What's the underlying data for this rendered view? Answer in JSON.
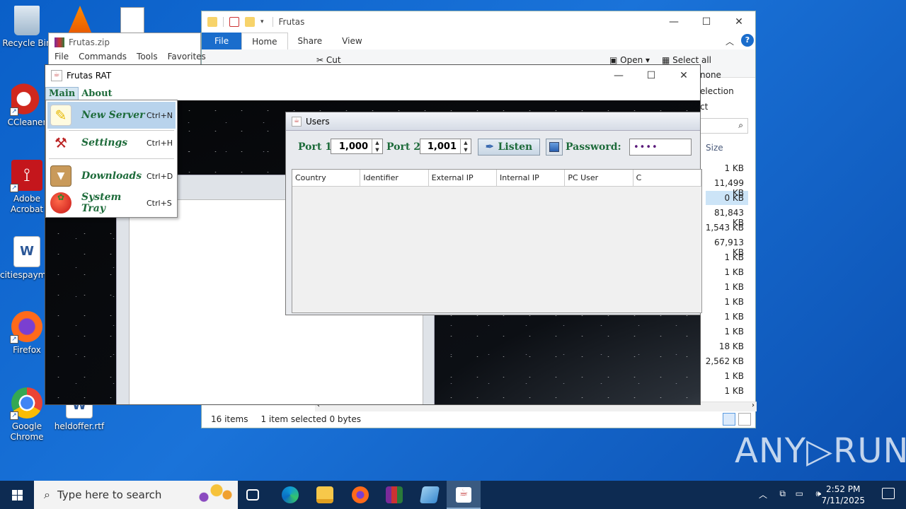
{
  "desktop": {
    "icons": [
      {
        "label": "Recycle Bin",
        "icon": "recycle-bin-icon"
      },
      {
        "label": "CCleaner",
        "icon": "ccleaner-icon"
      },
      {
        "label": "Adobe Acrobat",
        "icon": "adobe-acrobat-icon"
      },
      {
        "label": "citiespaym...",
        "icon": "word-document-icon"
      },
      {
        "label": "Firefox",
        "icon": "firefox-icon"
      },
      {
        "label": "Google Chrome",
        "icon": "chrome-icon"
      },
      {
        "label": "heldoffer.rtf",
        "icon": "word-document-icon"
      }
    ]
  },
  "zip_window": {
    "title": "Frutas.zip",
    "menu": [
      "File",
      "Commands",
      "Tools",
      "Favorites"
    ]
  },
  "explorer": {
    "title": "Frutas",
    "tabs": [
      "File",
      "Home",
      "Share",
      "View"
    ],
    "active_tab": "Home",
    "ribbon": {
      "cut": "Cut",
      "open": "Open",
      "select_all": "Select all",
      "select_none": "none",
      "invert": "election",
      "ct": "ct"
    },
    "column_header": "Size",
    "sizes": [
      "1 KB",
      "11,499 KB",
      "0 KB",
      "81,843 KB",
      "1,543 KB",
      "67,913 KB",
      "1 KB",
      "1 KB",
      "1 KB",
      "1 KB",
      "1 KB",
      "1 KB",
      "18 KB",
      "2,562 KB",
      "1 KB",
      "1 KB"
    ],
    "status": {
      "items": "16 items",
      "selected": "1 item selected",
      "bytes": "0 bytes"
    }
  },
  "rat_window": {
    "title": "Frutas RAT",
    "menu": [
      "Main",
      "About"
    ],
    "dropdown": [
      {
        "label": "New Server",
        "shortcut": "Ctrl+N",
        "icon": "pencil-icon"
      },
      {
        "label": "Settings",
        "shortcut": "Ctrl+H",
        "icon": "tools-icon"
      },
      {
        "label": "Downloads",
        "shortcut": "Ctrl+D",
        "icon": "box-icon"
      },
      {
        "label": "System Tray",
        "shortcut": "Ctrl+S",
        "icon": "strawberry-icon"
      }
    ]
  },
  "users_frame": {
    "title": "Users",
    "port1_label": "Port 1:",
    "port1_value": "1,000",
    "port2_label": "Port 2:",
    "port2_value": "1,001",
    "listen_label": "Listen",
    "password_label": "Password:",
    "password_value": "••••",
    "columns": [
      "Country",
      "Identifier",
      "External IP",
      "Internal IP",
      "PC User",
      "C"
    ]
  },
  "taskbar": {
    "search_placeholder": "Type here to search",
    "time": "2:52 PM",
    "date": "7/11/2025"
  },
  "watermark": "ANY▷RUN"
}
